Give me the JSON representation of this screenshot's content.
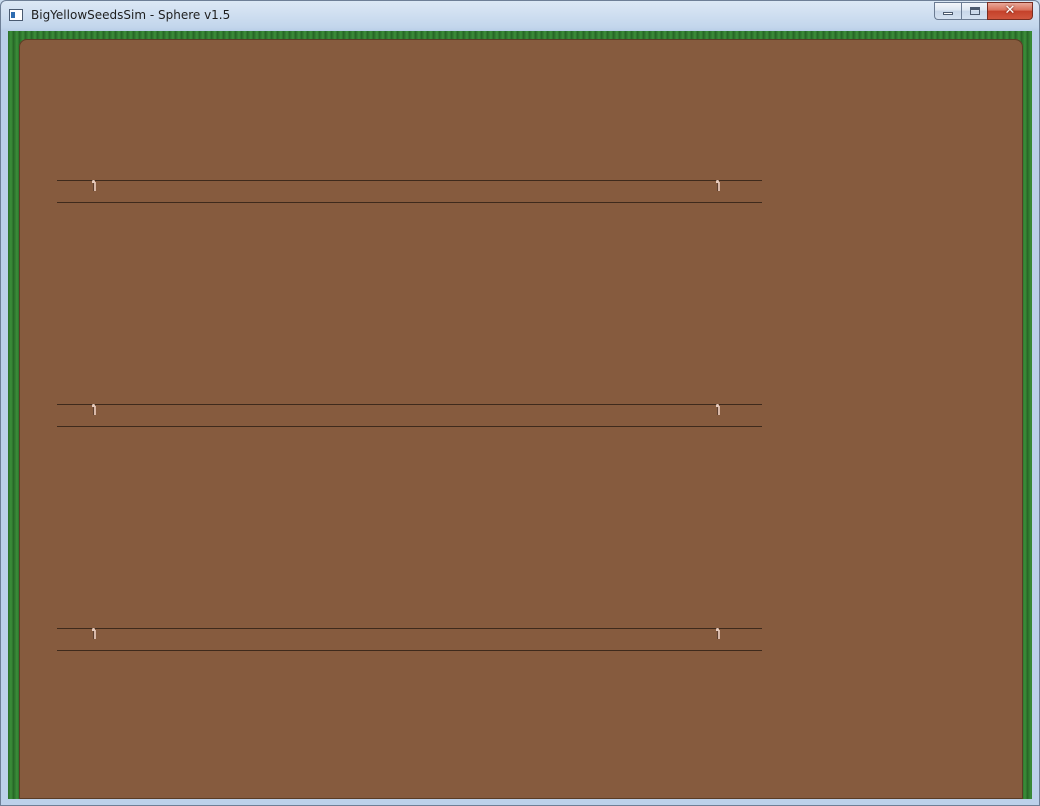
{
  "window": {
    "title": "BigYellowSeedsSim - Sphere v1.5",
    "icon": "app-window-icon",
    "buttons": [
      "minimize",
      "maximize",
      "close"
    ],
    "close_glyph": "✕"
  },
  "game": {
    "scene": "field",
    "colors": {
      "soil": "#865b3e",
      "grass_border": "#2f7a2f",
      "row_line": "#3e2a1c",
      "sprout": "#d8b8a8"
    },
    "rows": [
      {
        "id": "row-1",
        "sprouts": [
          "left",
          "right"
        ]
      },
      {
        "id": "row-2",
        "sprouts": [
          "left",
          "right"
        ]
      },
      {
        "id": "row-3",
        "sprouts": [
          "left",
          "right"
        ]
      }
    ]
  }
}
